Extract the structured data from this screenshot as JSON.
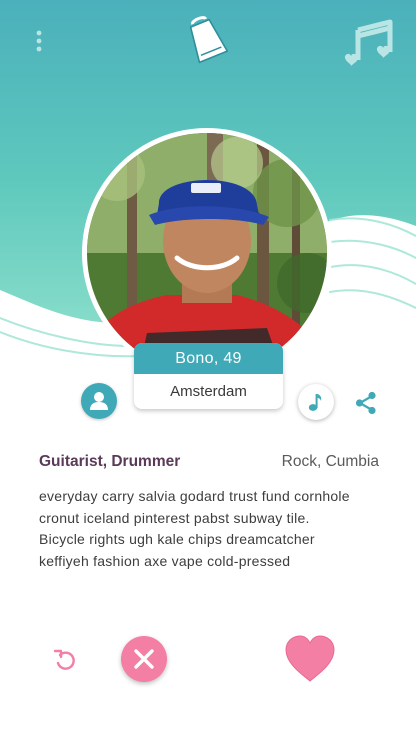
{
  "header": {
    "menu_icon": "more-vertical-icon",
    "logo_icon": "cowbell-icon",
    "music_icon": "music-notes-icon"
  },
  "profile": {
    "name_age": "Bono, 49",
    "city": "Amsterdam",
    "roles": "Guitarist, Drummer",
    "genres": "Rock, Cumbia",
    "bio": "everyday carry salvia godard trust fund cornhole cronut iceland pinterest pabst subway tile. Bicycle rights ugh kale chips dreamcatcher keffiyeh fashion axe vape cold-pressed"
  },
  "actions": {
    "profile_icon": "user-icon",
    "note_icon": "music-note-icon",
    "share_icon": "share-icon",
    "undo_icon": "undo-icon",
    "dislike_icon": "close-icon",
    "like_icon": "heart-icon"
  },
  "colors": {
    "teal": "#3fa9b8",
    "pink": "#f37fa4",
    "title_purple": "#5b3a58"
  }
}
